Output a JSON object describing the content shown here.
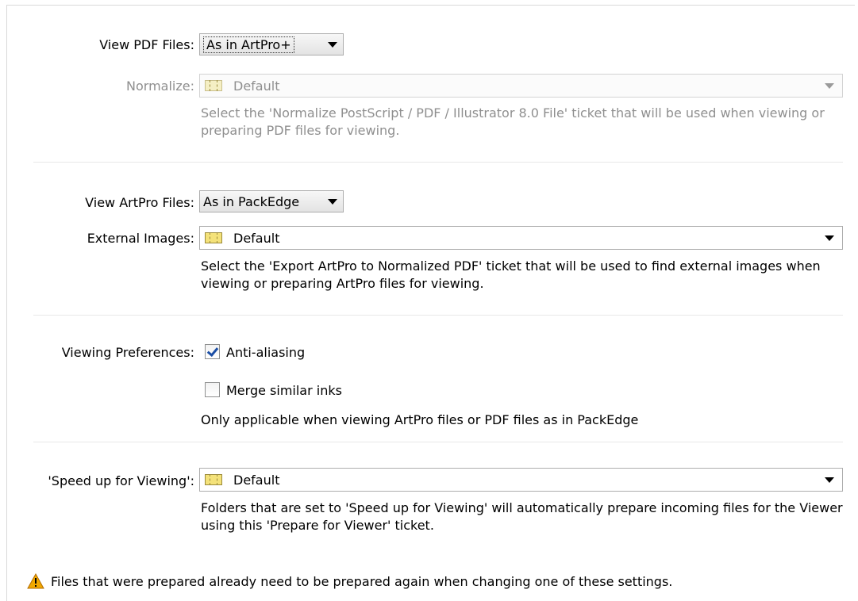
{
  "view_pdf": {
    "label": "View PDF Files:",
    "value": "As in ArtPro+"
  },
  "normalize": {
    "label": "Normalize:",
    "value": "Default",
    "help": "Select the 'Normalize PostScript / PDF / Illustrator 8.0 File' ticket that will be used when viewing or preparing PDF files for viewing."
  },
  "view_artpro": {
    "label": "View ArtPro Files:",
    "value": "As in PackEdge"
  },
  "external_images": {
    "label": "External Images:",
    "value": "Default",
    "help": "Select the 'Export ArtPro to Normalized PDF' ticket that will be used to find external images when viewing or preparing ArtPro files for viewing."
  },
  "viewing_prefs": {
    "label": "Viewing Preferences:",
    "anti_aliasing": {
      "label": "Anti-aliasing",
      "checked": true
    },
    "merge_inks": {
      "label": "Merge similar inks",
      "checked": false
    },
    "help": "Only applicable when viewing ArtPro files or PDF files as in PackEdge"
  },
  "speed_up": {
    "label": "'Speed up for Viewing':",
    "value": "Default",
    "help": "Folders that are set to 'Speed up for Viewing' will automatically prepare incoming files for the Viewer using this 'Prepare for Viewer' ticket."
  },
  "warning": {
    "icon": "warning-icon",
    "text": "Files that were prepared already need to be prepared again when changing one of these settings."
  },
  "icons": {
    "ticket": "ticket-icon",
    "dropdown": "chevron-down-icon",
    "check": "checkmark-icon"
  },
  "colors": {
    "disabled_text": "#8f8f8f",
    "check": "#1b4ea5",
    "warning": "#f0a800"
  }
}
